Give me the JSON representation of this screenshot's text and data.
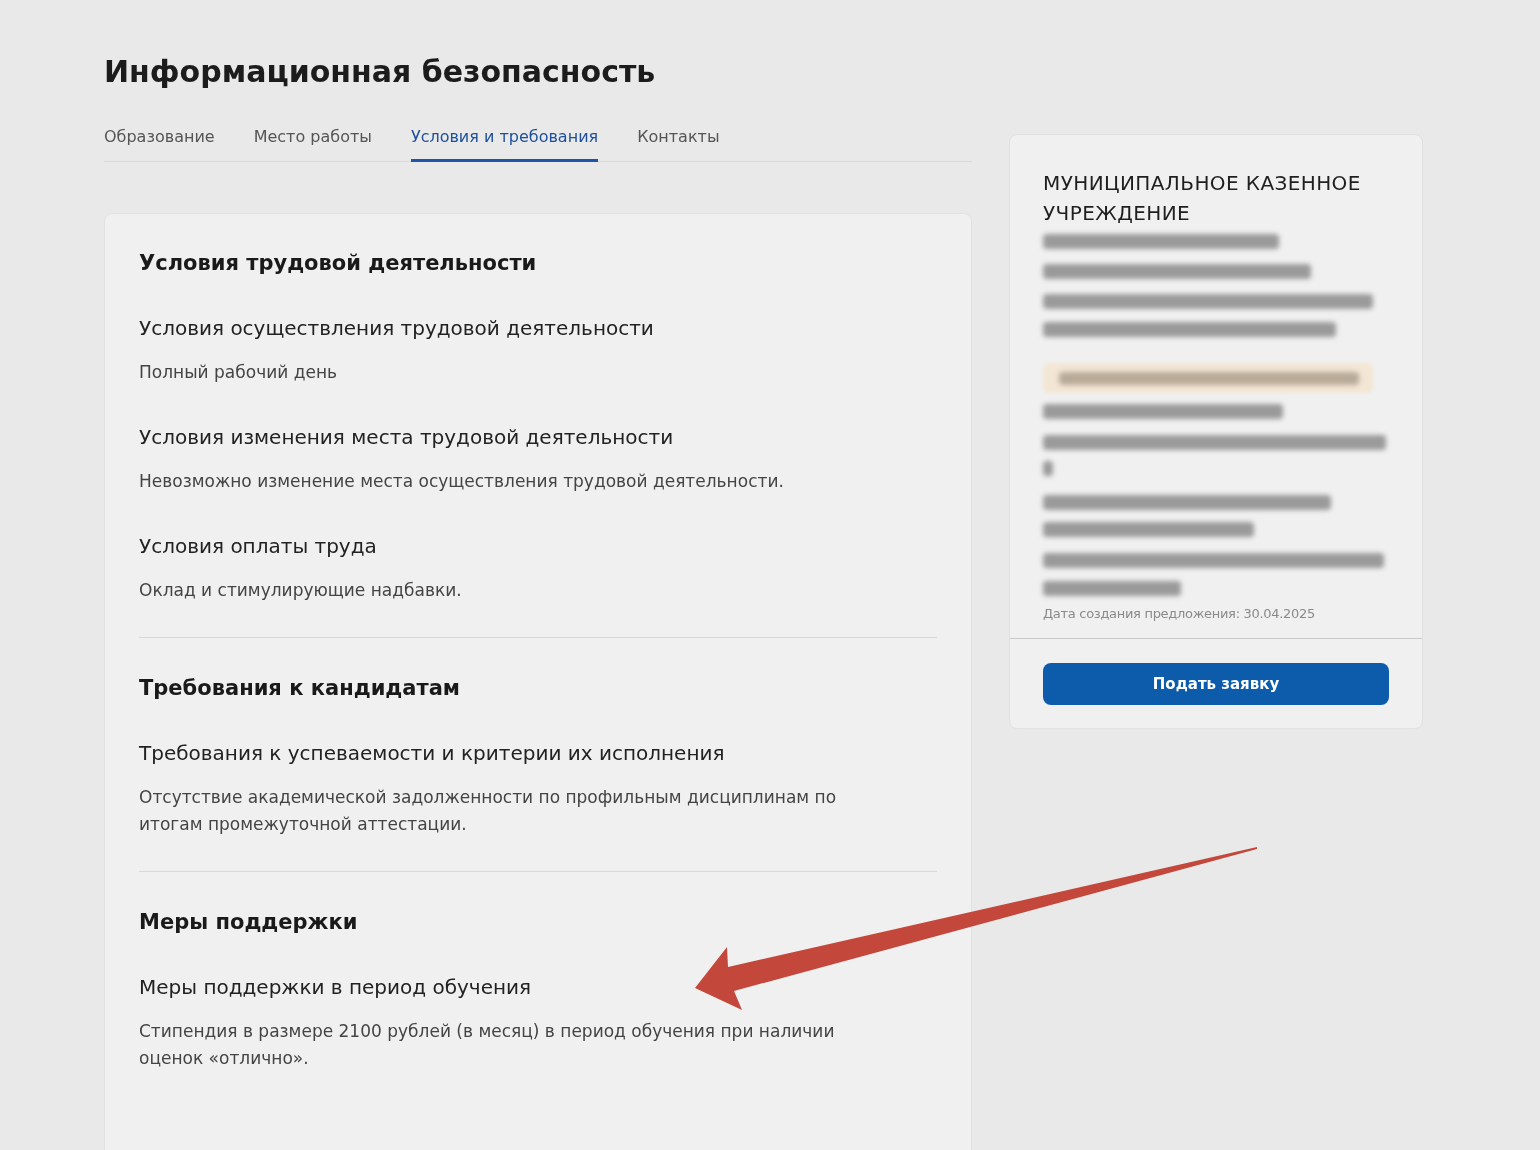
{
  "page": {
    "title": "Информационная безопасность"
  },
  "tabs": [
    {
      "label": "Образование",
      "selected": false
    },
    {
      "label": "Место работы",
      "selected": false
    },
    {
      "label": "Условия и требования",
      "selected": true
    },
    {
      "label": "Контакты",
      "selected": false
    }
  ],
  "sections": [
    {
      "title": "Условия трудовой деятельности",
      "items": [
        {
          "title": "Условия осуществления трудовой деятельности",
          "text": "Полный рабочий день"
        },
        {
          "title": "Условия изменения места трудовой деятельности",
          "text": "Невозможно изменение места осуществления трудовой деятельности."
        },
        {
          "title": "Условия оплаты труда",
          "text": "Оклад и стимулирующие надбавки."
        }
      ]
    },
    {
      "title": "Требования к кандидатам",
      "items": [
        {
          "title": "Требования к успеваемости и критерии их исполнения",
          "text": "Отсутствие академической задолженности по профильным дисциплинам по итогам промежуточной аттестации."
        }
      ]
    },
    {
      "title": "Меры поддержки",
      "items": [
        {
          "title": "Меры поддержки в период обучения",
          "text": "Стипендия в размере 2100 рублей (в месяц) в период обучения при наличии оценок «отлично»."
        }
      ]
    }
  ],
  "offer_card": {
    "organization": "МУНИЦИПАЛЬНОЕ КАЗЕННОЕ УЧРЕЖДЕНИЕ",
    "created": "Дата создания предложения: 30.04.2025",
    "apply_button": "Подать заявку"
  },
  "annotations": [
    {
      "kind": "arrow"
    }
  ]
}
